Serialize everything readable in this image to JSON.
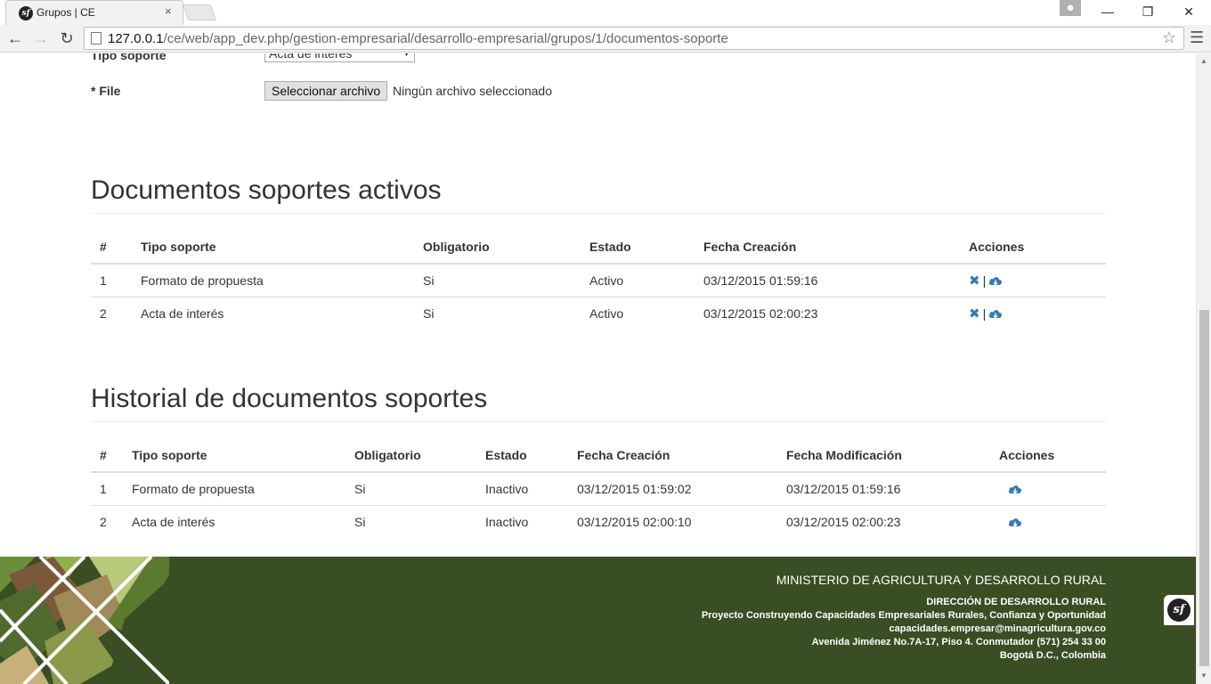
{
  "browser": {
    "tab_title": "Grupos | CE",
    "tab_close": "×",
    "favicon": "sf",
    "url_host": "127.0.0.1",
    "url_path": "/ce/web/app_dev.php/gestion-empresarial/desarrollo-empresarial/grupos/1/documentos-soporte",
    "minimize": "—",
    "maximize": "❐",
    "close": "✕"
  },
  "form": {
    "tipo_label": "Tipo soporte",
    "tipo_value": "Acta de interés",
    "file_label": "* File",
    "file_button": "Seleccionar archivo",
    "file_status": "Ningún archivo seleccionado"
  },
  "active": {
    "title": "Documentos soportes activos",
    "headers": [
      "#",
      "Tipo soporte",
      "Obligatorio",
      "Estado",
      "Fecha Creación",
      "Acciones"
    ],
    "rows": [
      {
        "n": "1",
        "tipo": "Formato de propuesta",
        "obligatorio": "Si",
        "estado": "Activo",
        "fecha": "03/12/2015 01:59:16"
      },
      {
        "n": "2",
        "tipo": "Acta de interés",
        "obligatorio": "Si",
        "estado": "Activo",
        "fecha": "03/12/2015 02:00:23"
      }
    ],
    "remove_glyph": "✖",
    "separator": "|"
  },
  "history": {
    "title": "Historial de documentos soportes",
    "headers": [
      "#",
      "Tipo soporte",
      "Obligatorio",
      "Estado",
      "Fecha Creación",
      "Fecha Modificación",
      "Acciones"
    ],
    "rows": [
      {
        "n": "1",
        "tipo": "Formato de propuesta",
        "obligatorio": "Si",
        "estado": "Inactivo",
        "fecha": "03/12/2015 01:59:02",
        "modificacion": "03/12/2015 01:59:16"
      },
      {
        "n": "2",
        "tipo": "Acta de interés",
        "obligatorio": "Si",
        "estado": "Inactivo",
        "fecha": "03/12/2015 02:00:10",
        "modificacion": "03/12/2015 02:00:23"
      }
    ]
  },
  "footer": {
    "ministry": "MINISTERIO DE AGRICULTURA Y DESARROLLO RURAL",
    "lines": [
      "DIRECCIÓN DE DESARROLLO RURAL",
      "Proyecto Construyendo Capacidades Empresariales Rurales, Confianza y Oportunidad",
      "capacidades.empresar@minagricultura.gov.co",
      "Avenida Jiménez No.7A-17, Piso 4. Conmutador (571) 254 33 00",
      "Bogotá D.C., Colombia"
    ],
    "badge": "sf"
  },
  "colors": {
    "footer_bg": "#3a4e24",
    "link_blue": "#337ab7"
  }
}
